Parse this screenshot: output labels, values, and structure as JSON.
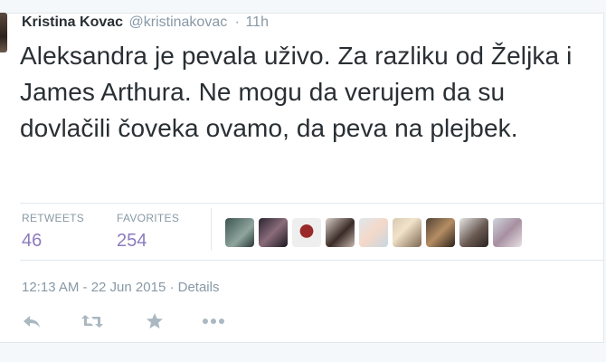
{
  "tweet": {
    "author": {
      "fullname": "Kristina Kovac",
      "screen_name": "@kristinakovac"
    },
    "separator": "·",
    "time_ago": "11h",
    "text": "Aleksandra je pevala uživo. Za razliku od Željka i James Arthura. Ne mogu da verujem da su dovlačili čoveka ovamo, da peva na plejbek.",
    "stats": {
      "retweets_label": "RETWEETS",
      "retweets": "46",
      "favorites_label": "FAVORITES",
      "favorites": "254"
    },
    "timestamp": "12:13 AM - 22 Jun 2015",
    "details_separator": "·",
    "details_link": "Details"
  },
  "colors": {
    "accent_count": "#8c7bbf",
    "muted": "#8899a6",
    "icon": "#aab8c2"
  },
  "icons": [
    "reply-icon",
    "retweet-icon",
    "favorite-icon",
    "more-icon"
  ]
}
